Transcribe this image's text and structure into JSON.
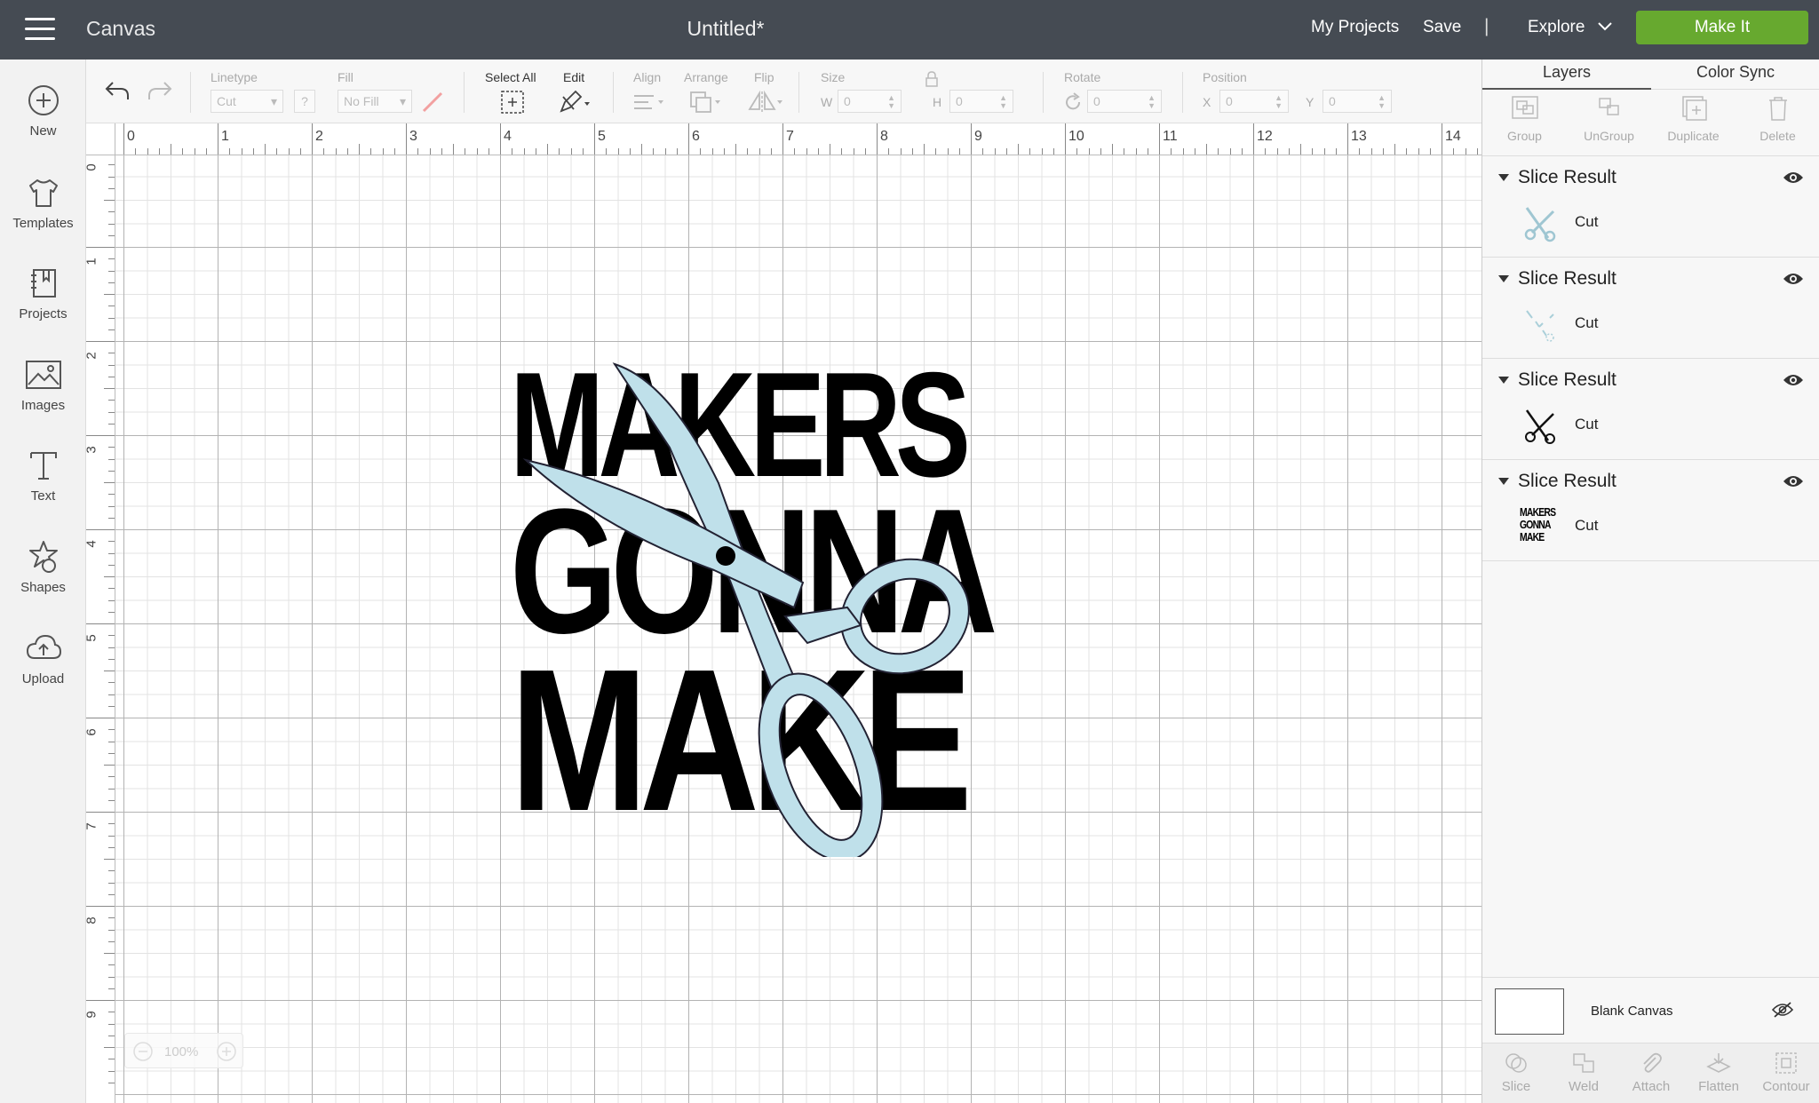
{
  "header": {
    "app_title": "Canvas",
    "doc_title": "Untitled*",
    "my_projects": "My Projects",
    "save": "Save",
    "separator": "|",
    "explore": "Explore",
    "make_it": "Make It",
    "make_it_color": "#67a92f",
    "bar_color": "#454b53"
  },
  "sidebar": {
    "items": [
      {
        "label": "New",
        "icon": "plus-circle-icon"
      },
      {
        "label": "Templates",
        "icon": "tshirt-icon"
      },
      {
        "label": "Projects",
        "icon": "notebook-icon"
      },
      {
        "label": "Images",
        "icon": "image-icon"
      },
      {
        "label": "Text",
        "icon": "text-icon"
      },
      {
        "label": "Shapes",
        "icon": "shapes-icon"
      },
      {
        "label": "Upload",
        "icon": "cloud-upload-icon"
      }
    ]
  },
  "toolbar": {
    "linetype_label": "Linetype",
    "linetype_value": "Cut",
    "help": "?",
    "fill_label": "Fill",
    "fill_value": "No Fill",
    "select_all": "Select All",
    "edit": "Edit",
    "align": "Align",
    "arrange": "Arrange",
    "flip": "Flip",
    "size_label": "Size",
    "w_label": "W",
    "w_value": "0",
    "h_label": "H",
    "h_value": "0",
    "rotate_label": "Rotate",
    "rotate_value": "0",
    "position_label": "Position",
    "x_label": "X",
    "x_value": "0",
    "y_label": "Y",
    "y_value": "0"
  },
  "ruler": {
    "top": [
      "0",
      "1",
      "2",
      "3",
      "4",
      "5",
      "6",
      "7",
      "8",
      "9",
      "10",
      "11",
      "12",
      "13",
      "14"
    ],
    "left": [
      "0",
      "1",
      "2",
      "3",
      "4",
      "5",
      "6",
      "7",
      "8",
      "9"
    ]
  },
  "design": {
    "lines": [
      "MAKERS",
      "GONNA",
      "MAKE"
    ],
    "scissors_color": "#bfe0ea"
  },
  "zoom": {
    "value": "100%"
  },
  "layers_panel": {
    "tabs": [
      "Layers",
      "Color Sync"
    ],
    "tools": [
      "Group",
      "UnGroup",
      "Duplicate",
      "Delete"
    ],
    "layers": [
      {
        "title": "Slice Result",
        "op": "Cut"
      },
      {
        "title": "Slice Result",
        "op": "Cut"
      },
      {
        "title": "Slice Result",
        "op": "Cut"
      },
      {
        "title": "Slice Result",
        "op": "Cut"
      }
    ],
    "thumb_words": [
      "MAKERS",
      "GONNA",
      "MAKE"
    ],
    "blank_canvas": "Blank Canvas",
    "bottom_tools": [
      "Slice",
      "Weld",
      "Attach",
      "Flatten",
      "Contour"
    ]
  }
}
